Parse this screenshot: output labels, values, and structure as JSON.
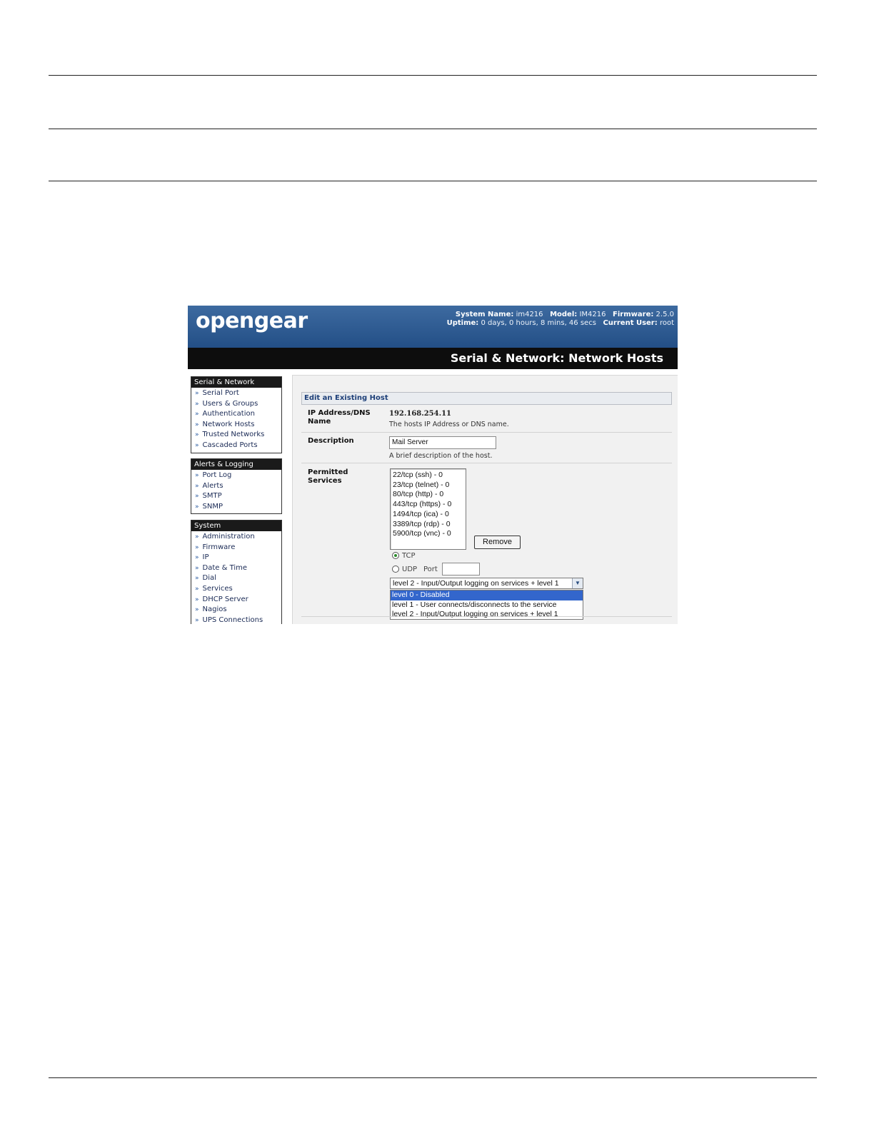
{
  "header": {
    "logo_text": "opengear",
    "system_name_label": "System Name:",
    "system_name": "im4216",
    "model_label": "Model:",
    "model": "IM4216",
    "firmware_label": "Firmware:",
    "firmware": "2.5.0",
    "uptime_label": "Uptime:",
    "uptime": "0 days, 0 hours, 8 mins, 46 secs",
    "current_user_label": "Current User:",
    "current_user": "root",
    "page_title": "Serial & Network: Network Hosts"
  },
  "sidebar": {
    "groups": [
      {
        "title": "Serial & Network",
        "items": [
          "Serial Port",
          "Users & Groups",
          "Authentication",
          "Network Hosts",
          "Trusted Networks",
          "Cascaded Ports"
        ]
      },
      {
        "title": "Alerts & Logging",
        "items": [
          "Port Log",
          "Alerts",
          "SMTP",
          "SNMP"
        ]
      },
      {
        "title": "System",
        "items": [
          "Administration",
          "Firmware",
          "IP",
          "Date & Time",
          "Dial",
          "Services",
          "DHCP Server",
          "Nagios",
          "UPS Connections"
        ]
      }
    ]
  },
  "form": {
    "section_title": "Edit an Existing Host",
    "ip_label_line1": "IP Address/DNS",
    "ip_label_line2": "Name",
    "ip_value": "192.168.254.11",
    "ip_hint": "The hosts IP Address or DNS name.",
    "description_label": "Description",
    "description_value": "Mail Server",
    "description_hint": "A brief description of the host.",
    "services_label_line1": "Permitted",
    "services_label_line2": "Services",
    "services": [
      "22/tcp (ssh) - 0",
      "23/tcp (telnet) - 0",
      "80/tcp (http) - 0",
      "443/tcp (https) - 0",
      "1494/tcp (ica) - 0",
      "3389/tcp (rdp) - 0",
      "5900/tcp (vnc) - 0"
    ],
    "remove_label": "Remove",
    "protocol_tcp": "TCP",
    "protocol_udp": "UDP",
    "protocol_selected": "TCP",
    "port_label": "Port",
    "port_value": "",
    "log_level_selected": "level 2 - Input/Output logging on services + level 1",
    "log_level_options": [
      "level 0 - Disabled",
      "level 1 - User connects/disconnects to the service",
      "level 2 - Input/Output logging on services + level 1"
    ],
    "log_level_highlighted": "level 0 - Disabled"
  },
  "colors": {
    "banner": "#2f5d94",
    "titlebar": "#0d0d0d",
    "highlight": "#3366cc",
    "section_text": "#1d3f78"
  }
}
